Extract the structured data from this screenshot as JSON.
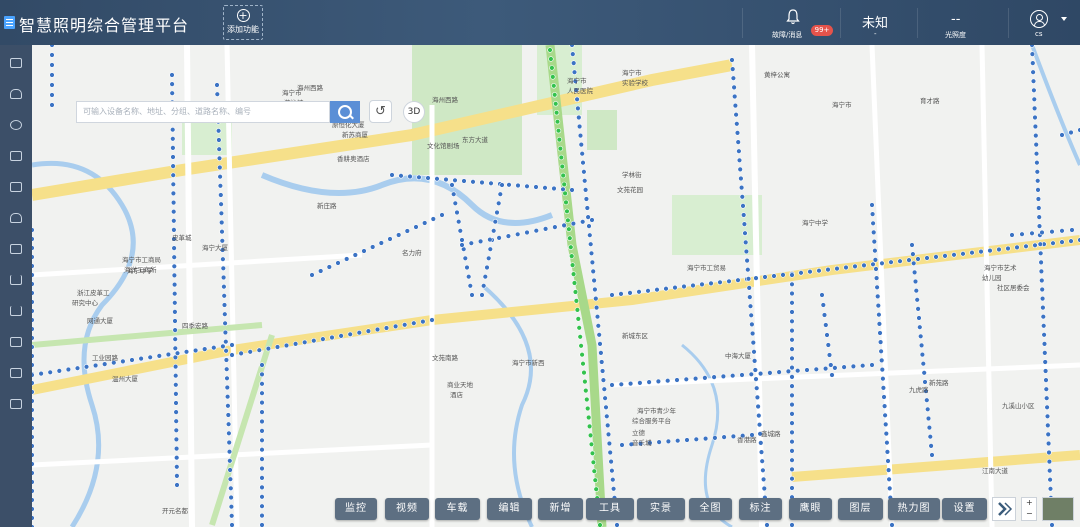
{
  "header": {
    "title": "智慧照明综合管理平台",
    "add_function": "添加功能",
    "alarm_label": "故障/消息",
    "alarm_badge": "99+",
    "weather_value": "未知",
    "weather_sub": "-",
    "illuminance_value": "--",
    "illuminance_label": "光照度",
    "user_name": "cs",
    "colors": {
      "header_bg": "#3d5a7a",
      "badge": "#e5534b",
      "sidebar_bg": "#3c4f68"
    }
  },
  "sidebar": {
    "items": [
      {
        "icon": "image-icon"
      },
      {
        "icon": "home-icon"
      },
      {
        "icon": "network-icon"
      },
      {
        "icon": "list-icon"
      },
      {
        "icon": "picture-icon"
      },
      {
        "icon": "dashboard-icon"
      },
      {
        "icon": "building-icon"
      },
      {
        "icon": "bar-chart-icon"
      },
      {
        "icon": "bar-chart-icon"
      },
      {
        "icon": "building-icon"
      },
      {
        "icon": "building-icon"
      },
      {
        "icon": "report-icon"
      }
    ]
  },
  "search": {
    "placeholder": "可输入设备名称、地址、分组、道路名称、编号",
    "reset_symbol": "↺",
    "view_3d": "3D"
  },
  "map": {
    "labels": [
      "海州西路",
      "海州西路",
      "海宁市",
      "游泳馆",
      "原恒化大厦",
      "新苏商厦",
      "香耕奥酒店",
      "文化馆剧场",
      "海宁市",
      "人民医院",
      "海宁市",
      "实验学校",
      "黄梓公寓",
      "海宁市",
      "育才路",
      "东方大道",
      "学林街",
      "文苑花园",
      "新庄路",
      "海宁中学",
      "皮革城",
      "海宁市工商局",
      "海洋工商所",
      "浙江皮革工",
      "研究中心",
      "网通大厦",
      "工业园路",
      "温州大厦",
      "海宁大厦",
      "四季宏路",
      "文苑南路",
      "商业天地",
      "酒店",
      "海宁市新西",
      "新城东区",
      "海宁市青少年",
      "综合服务平台",
      "立德",
      "音乐城",
      "海宁市工贸易",
      "海宁中学",
      "中海大厦",
      "新苑路",
      "九虎路",
      "九溪山小区",
      "海宁市艺术",
      "幼儿园",
      "社区居委会",
      "江南大道",
      "开元名都",
      "鑫城路",
      "香港路",
      "名力府"
    ]
  },
  "toolbar": {
    "buttons": [
      "监控",
      "视频",
      "车载",
      "编辑",
      "新增",
      "工具",
      "实景",
      "全图",
      "标注",
      "鹰眼",
      "图层",
      "热力图",
      "设置"
    ],
    "zoom_in": "+",
    "zoom_out": "−",
    "colors": {
      "button_bg": "#5d6f82",
      "lamp_blue": "#3b73c4",
      "lamp_green": "#33c24d"
    }
  }
}
